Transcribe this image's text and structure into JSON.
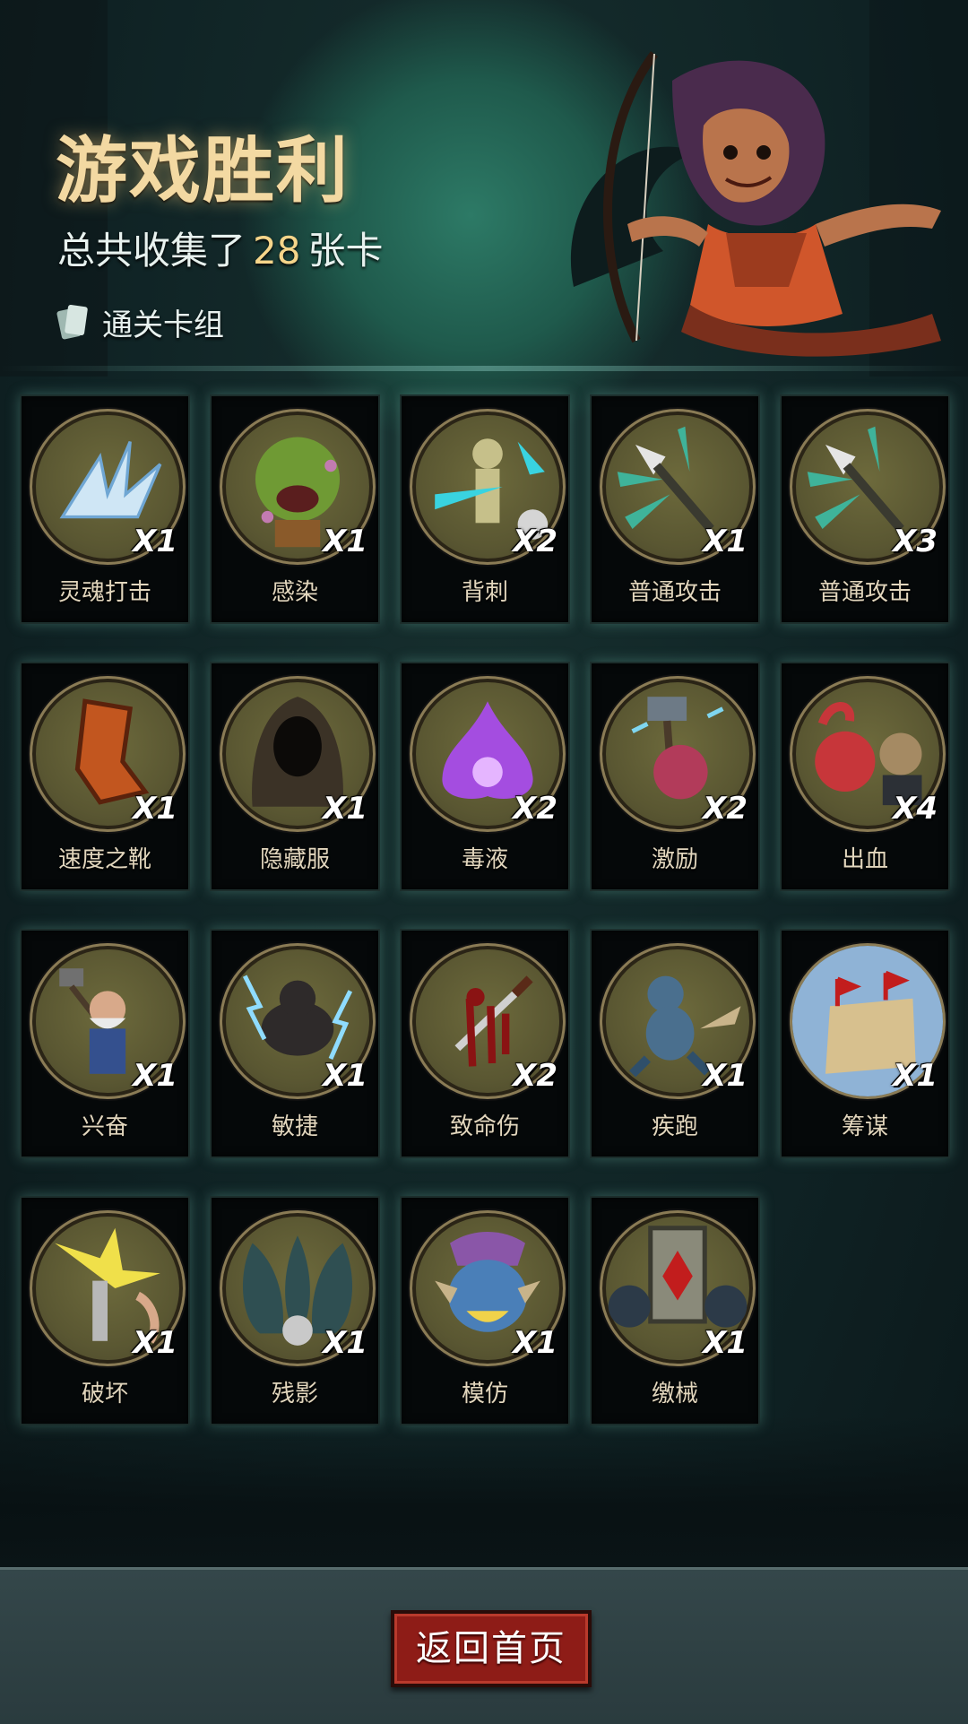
{
  "header": {
    "title": "游戏胜利",
    "subtitle_prefix": "总共收集了",
    "total_cards": "28",
    "subtitle_suffix": "张卡",
    "deck_label": "通关卡组"
  },
  "cards": [
    {
      "name": "灵魂打击",
      "count": "X1",
      "icon": "ice-shard-icon"
    },
    {
      "name": "感染",
      "count": "X1",
      "icon": "zombie-orc-icon"
    },
    {
      "name": "背刺",
      "count": "X2",
      "icon": "dummy-backstab-icon"
    },
    {
      "name": "普通攻击",
      "count": "X1",
      "icon": "spear-strike-icon"
    },
    {
      "name": "普通攻击",
      "count": "X3",
      "icon": "spear-strike-icon"
    },
    {
      "name": "速度之靴",
      "count": "X1",
      "icon": "boot-icon"
    },
    {
      "name": "隐藏服",
      "count": "X1",
      "icon": "hood-cloak-icon"
    },
    {
      "name": "毒液",
      "count": "X2",
      "icon": "poison-splash-icon"
    },
    {
      "name": "激励",
      "count": "X2",
      "icon": "hammer-brute-icon"
    },
    {
      "name": "出血",
      "count": "X4",
      "icon": "octopus-goblin-icon"
    },
    {
      "name": "兴奋",
      "count": "X1",
      "icon": "dwarf-hammer-icon"
    },
    {
      "name": "敏捷",
      "count": "X1",
      "icon": "panther-lightning-icon"
    },
    {
      "name": "致命伤",
      "count": "X2",
      "icon": "bloody-dagger-icon"
    },
    {
      "name": "疾跑",
      "count": "X1",
      "icon": "running-beast-icon"
    },
    {
      "name": "筹谋",
      "count": "X1",
      "icon": "battle-map-icon"
    },
    {
      "name": "破坏",
      "count": "X1",
      "icon": "broken-bolt-icon"
    },
    {
      "name": "残影",
      "count": "X1",
      "icon": "shadow-clones-icon"
    },
    {
      "name": "模仿",
      "count": "X1",
      "icon": "goblin-mimic-icon"
    },
    {
      "name": "缴械",
      "count": "X1",
      "icon": "diamond-shield-icon"
    }
  ],
  "footer": {
    "home_button": "返回首页"
  },
  "colors": {
    "title_gold": "#f3d9a2",
    "count_highlight": "#f5d58a",
    "button_red": "#8e1c17",
    "card_glow": "#78c8b4"
  }
}
